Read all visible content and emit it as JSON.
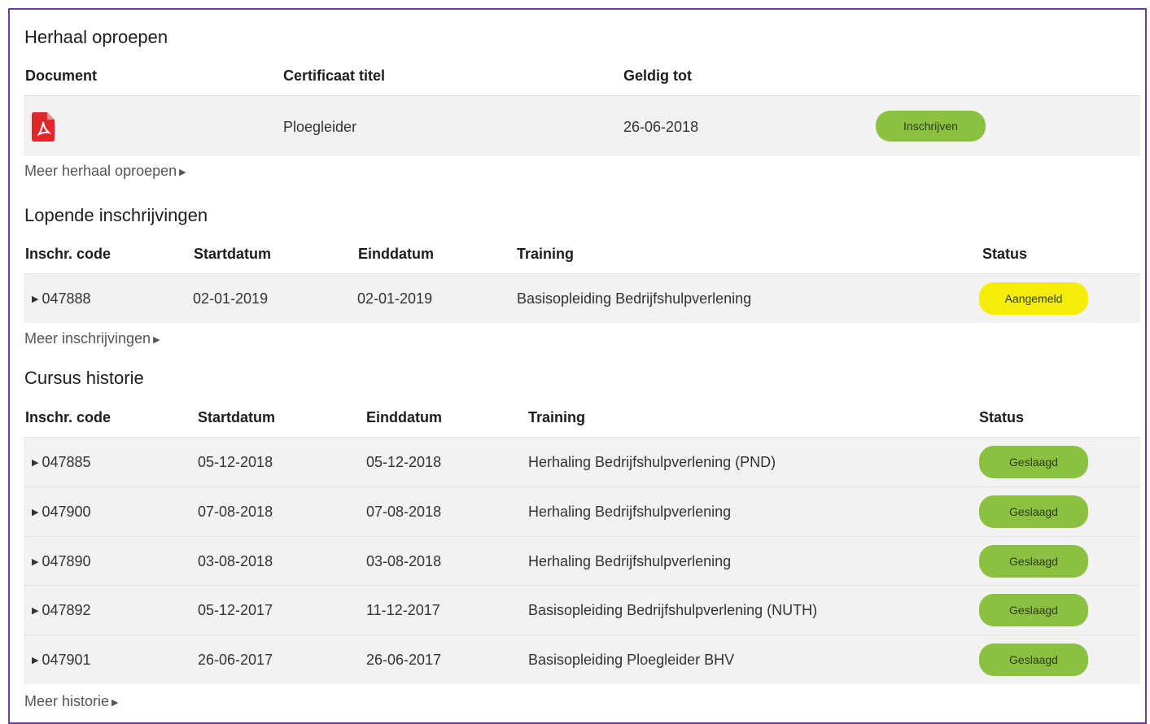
{
  "colors": {
    "frame": "#6b3fa0",
    "green": "#8cc041",
    "yellow": "#f6ec0a",
    "pdf": "#e0262b"
  },
  "icons": {
    "pdf": "pdf-file-icon",
    "expand": "caret-right-icon",
    "more": "caret-right-icon"
  },
  "herhaal": {
    "title": "Herhaal oproepen",
    "headers": {
      "document": "Document",
      "titel": "Certificaat titel",
      "geldig": "Geldig tot"
    },
    "rows": [
      {
        "titel": "Ploegleider",
        "geldig": "26-06-2018",
        "action": "Inschrijven"
      }
    ],
    "more": "Meer herhaal oproepen"
  },
  "lopende": {
    "title": "Lopende inschrijvingen",
    "headers": {
      "code": "Inschr. code",
      "start": "Startdatum",
      "eind": "Einddatum",
      "training": "Training",
      "status": "Status"
    },
    "rows": [
      {
        "code": "047888",
        "start": "02-01-2019",
        "eind": "02-01-2019",
        "training": "Basisopleiding Bedrijfshulpverlening",
        "status": "Aangemeld"
      }
    ],
    "more": "Meer inschrijvingen"
  },
  "historie": {
    "title": "Cursus historie",
    "headers": {
      "code": "Inschr. code",
      "start": "Startdatum",
      "eind": "Einddatum",
      "training": "Training",
      "status": "Status"
    },
    "rows": [
      {
        "code": "047885",
        "start": "05-12-2018",
        "eind": "05-12-2018",
        "training": "Herhaling Bedrijfshulpverlening (PND)",
        "status": "Geslaagd"
      },
      {
        "code": "047900",
        "start": "07-08-2018",
        "eind": "07-08-2018",
        "training": "Herhaling Bedrijfshulpverlening",
        "status": "Geslaagd"
      },
      {
        "code": "047890",
        "start": "03-08-2018",
        "eind": "03-08-2018",
        "training": "Herhaling Bedrijfshulpverlening",
        "status": "Geslaagd"
      },
      {
        "code": "047892",
        "start": "05-12-2017",
        "eind": "11-12-2017",
        "training": "Basisopleiding Bedrijfshulpverlening (NUTH)",
        "status": "Geslaagd"
      },
      {
        "code": "047901",
        "start": "26-06-2017",
        "eind": "26-06-2017",
        "training": "Basisopleiding Ploegleider BHV",
        "status": "Geslaagd"
      }
    ],
    "more": "Meer historie"
  }
}
